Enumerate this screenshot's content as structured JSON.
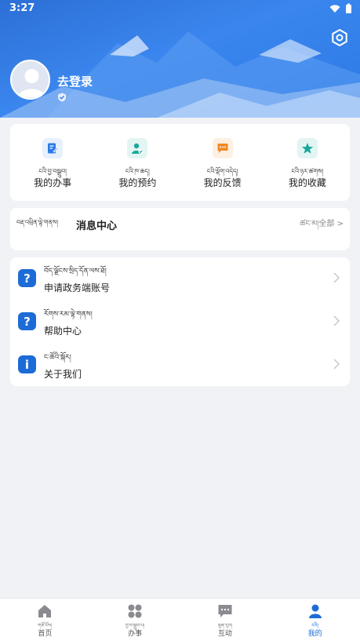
{
  "status_bar": {
    "time": "3:27"
  },
  "profile": {
    "login_label": "去登录"
  },
  "quick_actions": [
    {
      "tibetan": "ངའི་བྱ་བསྒྲུབ།",
      "label": "我的办事",
      "icon": "edit-icon",
      "color": "#2b79e6"
    },
    {
      "tibetan": "ངའི་ཁ་ཆད།",
      "label": "我的预约",
      "icon": "user-check-icon",
      "color": "#1aa89c"
    },
    {
      "tibetan": "ངའི་ལྡོག་འདེད།",
      "label": "我的反馈",
      "icon": "chat-icon",
      "color": "#f08a24"
    },
    {
      "tibetan": "ངའི་ཉར་ཚགས།",
      "label": "我的收藏",
      "icon": "star-icon",
      "color": "#1aa89c"
    }
  ],
  "message_center": {
    "tibetan": "བརྡ་འཕྲིན་ལྟེ་གནས།",
    "title": "消息中心",
    "all_label": "ཚང་མ།全部  >"
  },
  "menu": [
    {
      "tibetan": "བོད་ལྗོངས་སྲིད་དོན་ལས་ཐོ།",
      "label": "申请政务端账号",
      "icon": "question-icon",
      "glyph": "?"
    },
    {
      "tibetan": "རོགས་རམ་ལྟེ་གནས།",
      "label": "帮助中心",
      "icon": "question-icon",
      "glyph": "?"
    },
    {
      "tibetan": "ང་ཚོའི་སྐོར།",
      "label": "关于我们",
      "icon": "info-icon",
      "glyph": "i"
    }
  ],
  "tabs": [
    {
      "tibetan": "གཙོ་ངོས།",
      "label": "首页",
      "icon": "home-icon",
      "active": false
    },
    {
      "tibetan": "བྱ་བ་སྒྲུབ་པ།",
      "label": "办事",
      "icon": "grid-icon",
      "active": false
    },
    {
      "tibetan": "ལྷན་རུབ།",
      "label": "互动",
      "icon": "chat-icon",
      "active": false
    },
    {
      "tibetan": "ངའི།",
      "label": "我的",
      "icon": "person-icon",
      "active": true
    }
  ],
  "colors": {
    "primary": "#1d6bd6",
    "background": "#f1f2f6"
  }
}
